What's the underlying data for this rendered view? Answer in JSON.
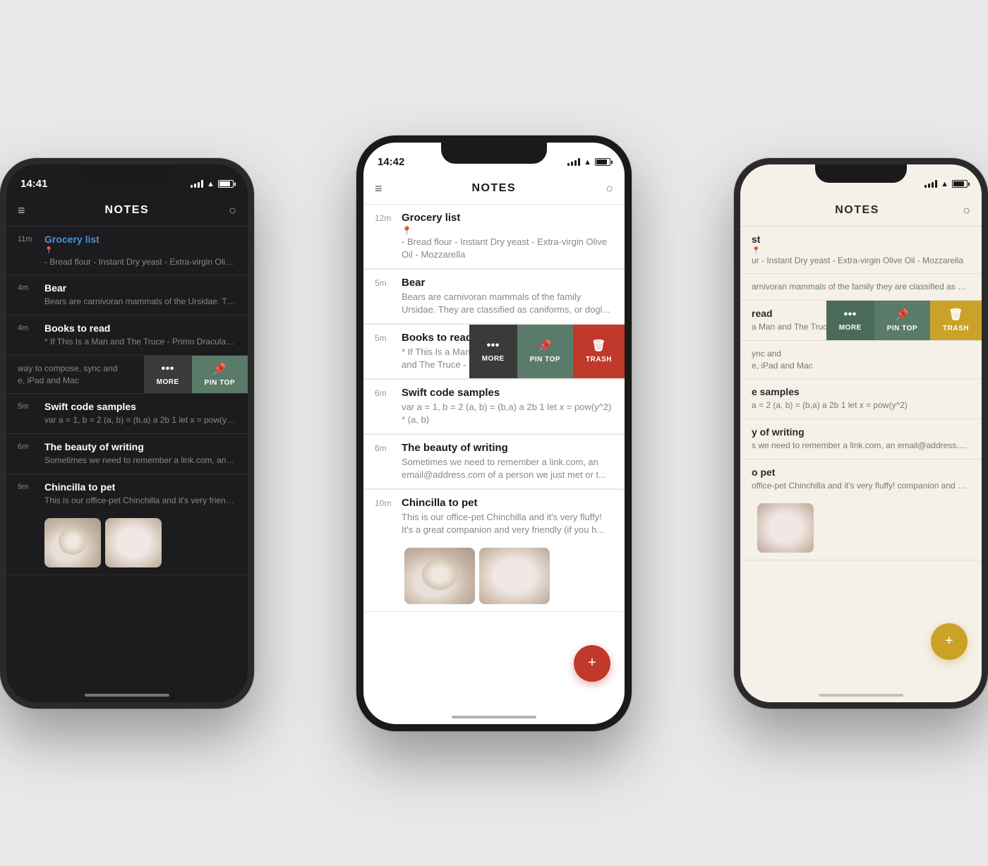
{
  "phones": {
    "left": {
      "time": "14:41",
      "theme": "dark",
      "title": "NOTES",
      "notes": [
        {
          "time": "11m",
          "title": "Grocery list",
          "preview": "- Bread flour - Instant Dry yeast - Extra-virgin Olive Oil - Mozzarella",
          "pin": true,
          "swipe": true
        },
        {
          "time": "4m",
          "title": "Bear",
          "preview": "Bears are carnivoran mammals of the Ursidae. They are classified as canifor...",
          "pin": false,
          "swipe": false
        },
        {
          "time": "4m",
          "title": "Books to read",
          "preview": "* If This Is a Man and The Truce - Primo Dracula - Bram Stocker",
          "pin": false,
          "swipe": false,
          "swipeVisible": true
        },
        {
          "time": "",
          "title": "way to compose, sync and",
          "preview": "e, iPad and Mac",
          "pin": false,
          "swipe": false,
          "swipeButtons": true
        },
        {
          "time": "5m",
          "title": "Swift code samples",
          "preview": "var a = 1, b = 2 (a, b) = (b,a) a 2b 1 let x = pow(y^2) * (a, b)",
          "pin": false,
          "swipe": false
        },
        {
          "time": "6m",
          "title": "The beauty of writing",
          "preview": "Sometimes we need to remember a link.com, an email@address.com of a person we j...",
          "pin": false,
          "swipe": false
        },
        {
          "time": "9m",
          "title": "Chincilla to pet",
          "preview": "This is our office-pet Chinchilla and it's very friendly (if you h...",
          "pin": false,
          "swipe": false,
          "hasImages": true
        }
      ],
      "swipeButtons": [
        "MORE",
        "PIN TOP"
      ]
    },
    "center": {
      "time": "14:42",
      "theme": "light",
      "title": "NOTES",
      "notes": [
        {
          "time": "12m",
          "title": "Grocery list",
          "preview": "- Bread flour - Instant Dry yeast - Extra-virgin Olive Oil - Mozzarella",
          "pin": true,
          "swipe": false
        },
        {
          "time": "5m",
          "title": "Bear",
          "preview": "Bears are carnivoran mammals of the family Ursidae. They are classified as caniforms, or dogl...",
          "pin": false,
          "swipe": false
        },
        {
          "time": "5m",
          "title": "Books to read",
          "preview": "* If This Is a Man and The Truce - Primo Levi * Dracula - Bram Stocker",
          "pin": false,
          "swipe": true,
          "swipeButtons": true
        },
        {
          "time": "6m",
          "title": "Swift code samples",
          "preview": "var a = 1, b = 2 (a, b) = (b,a) a 2b 1 let x = pow(y^2) * (a, b)",
          "pin": false,
          "swipe": false
        },
        {
          "time": "6m",
          "title": "The beauty of writing",
          "preview": "Sometimes we need to remember a link.com, an email@address.com of a person we just met or t...",
          "pin": false,
          "swipe": false
        },
        {
          "time": "10m",
          "title": "Chincilla to pet",
          "preview": "This is our office-pet Chinchilla and it's very fluffy! It's a great companion and very friendly (if you h...",
          "pin": false,
          "swipe": false,
          "hasImages": true
        }
      ],
      "swipeButtons": [
        "MORE",
        "PIN TOP",
        "TRASH"
      ]
    },
    "right": {
      "time": "",
      "theme": "warm",
      "title": "NOTES",
      "notes": [
        {
          "time": "",
          "title": "st",
          "preview": "ur - Instant Dry yeast - Extra-virgin Olive Oil - Mozzarella",
          "pin": true,
          "swipe": false
        },
        {
          "time": "",
          "title": "",
          "preview": "arnivoran mammals of the family they are classified as caniforms, or dogl...",
          "pin": false,
          "swipe": false
        },
        {
          "time": "",
          "title": "read",
          "preview": "a Man and The Truce - Primo Levi * Bram Stocker",
          "pin": false,
          "swipe": true,
          "swipeButtons": true
        },
        {
          "time": "",
          "title": "ync and",
          "preview": "e, iPad and Mac",
          "pin": false,
          "swipe": false
        },
        {
          "time": "",
          "title": "e samples",
          "preview": "a = 2 (a, b) = (b,a) a 2b 1 let x = pow(y^2)",
          "pin": false,
          "swipe": false
        },
        {
          "time": "",
          "title": "y of writing",
          "preview": "s we need to remember a link.com, an email@address.com of a person we just met or t...",
          "pin": false,
          "swipe": false
        },
        {
          "time": "",
          "title": "o pet",
          "preview": "office-pet Chinchilla and it's very fluffy! companion and very friendly (if you h...",
          "pin": false,
          "swipe": false,
          "hasImages": true
        }
      ],
      "swipeButtons": [
        "MORE",
        "PIN TOP",
        "TRASH"
      ]
    }
  },
  "labels": {
    "notes_title": "NOTES",
    "more": "MORE",
    "pin_top": "PIN TOP",
    "trash": "TRASH",
    "new_note": "+",
    "menu_icon": "≡",
    "search_icon": "⌕"
  }
}
